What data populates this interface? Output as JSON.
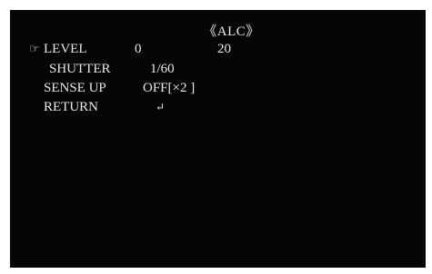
{
  "osd": {
    "title": "《ALC》",
    "cursor_icon": "pointing-hand-icon",
    "cursor_glyph": "☞",
    "items": [
      {
        "label": "LEVEL",
        "value": "0",
        "extra": "20"
      },
      {
        "label": "SHUTTER",
        "value": "1/60"
      },
      {
        "label": "SENSE UP",
        "value": "OFF[×2  ]"
      },
      {
        "label": "RETURN",
        "value": "↵",
        "value_icon": "return-arrow-icon"
      }
    ]
  }
}
